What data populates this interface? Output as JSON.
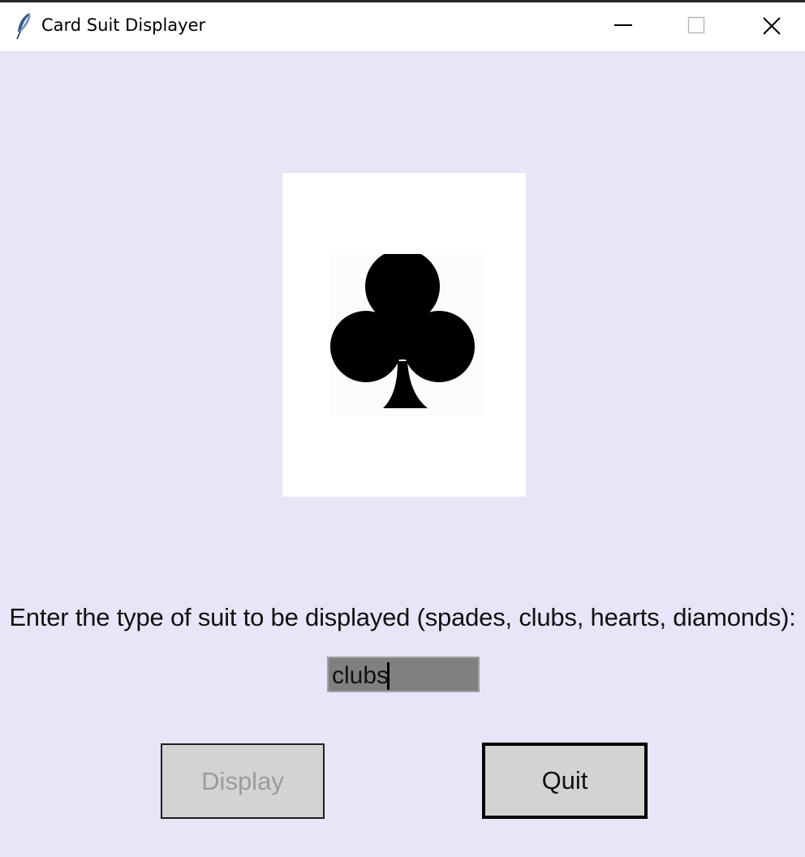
{
  "window": {
    "title": "Card Suit Displayer",
    "controls": [
      "minimize",
      "maximize",
      "close"
    ]
  },
  "card": {
    "suit": "clubs",
    "suit_icon": "club-icon",
    "background": "#ffffff",
    "suit_color": "#000000"
  },
  "form": {
    "prompt": "Enter the type of suit to be displayed (spades, clubs, hearts, diamonds):",
    "suit_input_value": "clubs"
  },
  "buttons": {
    "display_label": "Display",
    "display_state": "disabled",
    "quit_label": "Quit"
  },
  "colors": {
    "window_background": "#e6e6f8",
    "entry_background": "#808080",
    "button_background": "#d3d3d3",
    "disabled_text": "#9b9b9b"
  }
}
